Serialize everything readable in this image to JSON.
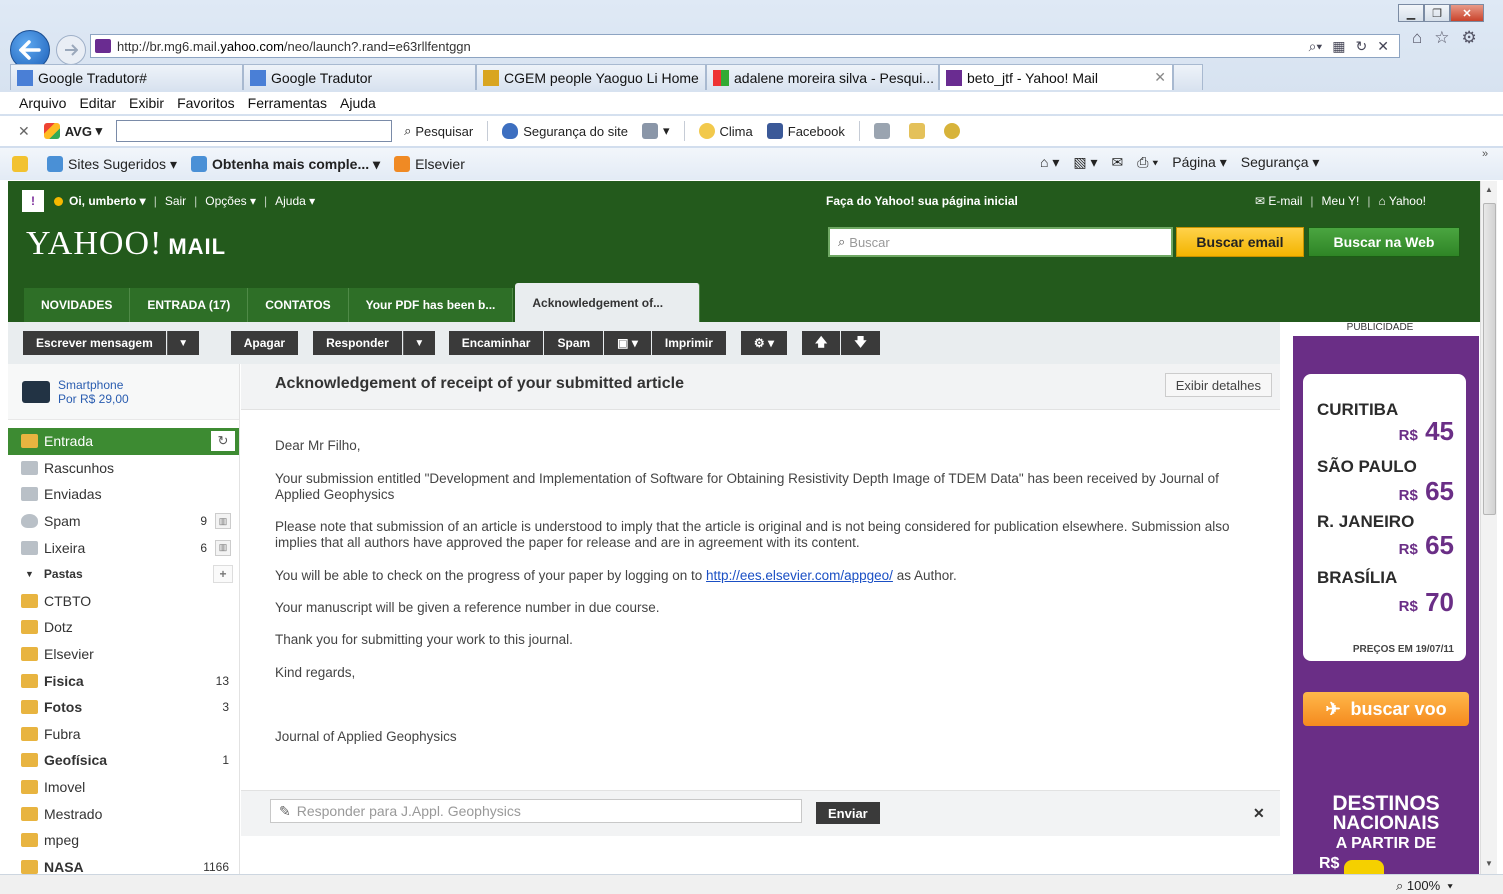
{
  "browser": {
    "url": "http://br.mg6.mail.yahoo.com/neo/launch?.rand=e63rllfentggn",
    "url_prefix": "http://br.mg6.mail.",
    "url_domain": "yahoo.com",
    "url_suffix": "/neo/launch?.rand=e63rllfentggn",
    "tabs": [
      {
        "label": "Google Tradutor#"
      },
      {
        "label": "Google Tradutor"
      },
      {
        "label": "CGEM people Yaoguo Li Home"
      },
      {
        "label": "adalene moreira silva - Pesqui..."
      },
      {
        "label": "beto_jtf - Yahoo! Mail",
        "active": true
      }
    ],
    "menu": [
      "Arquivo",
      "Editar",
      "Exibir",
      "Favoritos",
      "Ferramentas",
      "Ajuda"
    ],
    "avg_toolbar": {
      "brand": "AVG",
      "search_label": "Pesquisar",
      "security_label": "Segurança do site",
      "weather_label": "Clima",
      "facebook_label": "Facebook"
    },
    "favorites": {
      "sites": "Sites Sugeridos",
      "more": "Obtenha mais comple...",
      "elsevier": "Elsevier",
      "page": "Página",
      "security": "Segurança"
    },
    "zoom": "100%"
  },
  "yahoo": {
    "greeting": "Oi, umberto",
    "links": [
      "Sair",
      "Opções",
      "Ajuda"
    ],
    "promo_home": "Faça do Yahoo! sua página inicial",
    "right_links": [
      "E-mail",
      "Meu Y!",
      "Yahoo!"
    ],
    "logo": "YAHOO!",
    "logo_mail": "MAIL",
    "search_placeholder": "Buscar",
    "btn_search_email": "Buscar email",
    "btn_search_web": "Buscar na Web",
    "tabs": [
      "NOVIDADES",
      "ENTRADA (17)",
      "CONTATOS",
      "Your PDF has been b...",
      "Acknowledgement of..."
    ]
  },
  "toolbar": {
    "compose": "Escrever mensagem",
    "delete": "Apagar",
    "reply": "Responder",
    "forward": "Encaminhar",
    "spam": "Spam",
    "print": "Imprimir"
  },
  "sidebar": {
    "promo_line1": "Smartphone",
    "promo_line2": "Por R$ 29,00",
    "folders": [
      {
        "label": "Entrada"
      },
      {
        "label": "Rascunhos"
      },
      {
        "label": "Enviadas"
      },
      {
        "label": "Spam",
        "count": "9"
      },
      {
        "label": "Lixeira",
        "count": "6"
      },
      {
        "label": "Pastas"
      },
      {
        "label": "CTBTO"
      },
      {
        "label": "Dotz"
      },
      {
        "label": "Elsevier"
      },
      {
        "label": "Fisica",
        "count": "13"
      },
      {
        "label": "Fotos",
        "count": "3"
      },
      {
        "label": "Fubra"
      },
      {
        "label": "Geofísica",
        "count": "1"
      },
      {
        "label": "Imovel"
      },
      {
        "label": "Mestrado"
      },
      {
        "label": "mpeg"
      },
      {
        "label": "NASA",
        "count": "1166"
      }
    ]
  },
  "message": {
    "subject": "Acknowledgement of receipt of your submitted article",
    "details_button": "Exibir detalhes",
    "greeting": "Dear Mr Filho,",
    "p1": "Your submission entitled \"Development and Implementation of Software for Obtaining Resistivity Depth Image of TDEM Data\" has been received by Journal of Applied Geophysics",
    "p2": "Please note that submission of an article is understood to imply that the article is original and is not being considered for publication elsewhere. Submission also implies that all authors have approved the paper for release and are in agreement with its content.",
    "p3_before": "You will be able to check on the progress of your paper by logging on to",
    "p3_link": "http://ees.elsevier.com/appgeo/",
    "p3_after": "as Author.",
    "p4": "Your manuscript will be given a reference number in due course.",
    "p5": "Thank you for submitting your work to this journal.",
    "p6": "Kind regards,",
    "signature": "Journal of Applied Geophysics",
    "reply_placeholder": "Responder para J.Appl. Geophysics",
    "send_button": "Enviar"
  },
  "ad": {
    "label": "PUBLICIDADE",
    "cities": [
      {
        "city": "CURITIBA",
        "currency": "R$",
        "price": "45"
      },
      {
        "city": "SÃO PAULO",
        "currency": "R$",
        "price": "65"
      },
      {
        "city": "R. JANEIRO",
        "currency": "R$",
        "price": "65"
      },
      {
        "city": "BRASÍLIA",
        "currency": "R$",
        "price": "70"
      }
    ],
    "prices_date": "PREÇOS EM 19/07/11",
    "cta": "buscar voo",
    "destinos1": "DESTINOS",
    "destinos2": "NACIONAIS",
    "destinos3": "A PARTIR DE",
    "destinos4": "R$"
  }
}
